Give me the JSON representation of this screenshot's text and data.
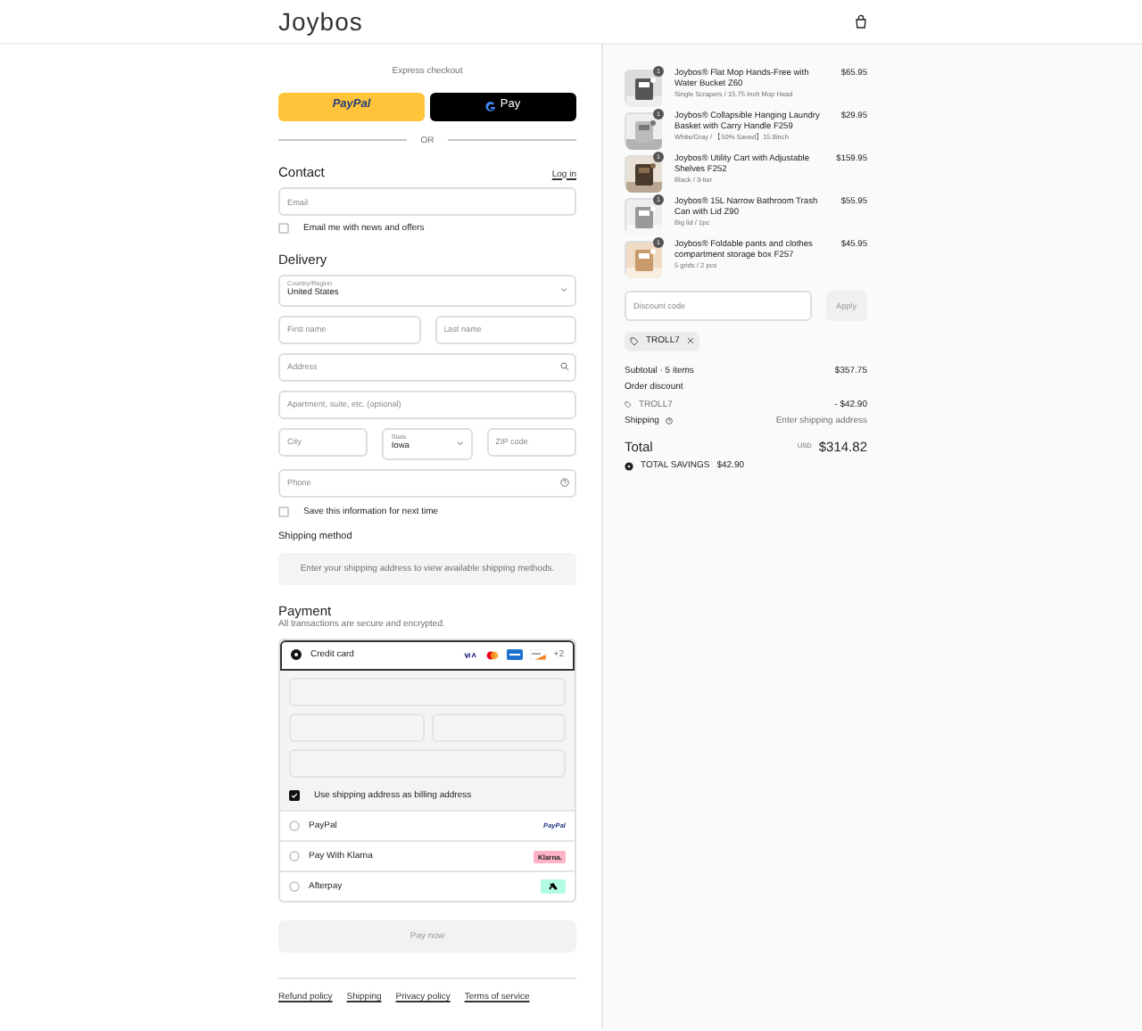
{
  "header": {
    "logo": "Joybos"
  },
  "express": {
    "title": "Express checkout",
    "buttons": [
      {
        "kind": "paypal",
        "label": "PayPal"
      },
      {
        "kind": "gpay",
        "label": "Pay"
      }
    ],
    "divider": "OR"
  },
  "contact": {
    "title": "Contact",
    "login": "Log in",
    "email_placeholder": "Email",
    "newsletter": {
      "label": "Email me with news and offers",
      "checked": false
    }
  },
  "delivery": {
    "title": "Delivery",
    "country": {
      "label": "Country/Region",
      "value": "United States"
    },
    "first_name": {
      "placeholder": "First name"
    },
    "last_name": {
      "placeholder": "Last name"
    },
    "address": {
      "placeholder": "Address"
    },
    "apartment": {
      "placeholder": "Apartment, suite, etc. (optional)"
    },
    "city": {
      "placeholder": "City"
    },
    "state": {
      "label": "State",
      "value": "Iowa"
    },
    "zip": {
      "placeholder": "ZIP code"
    },
    "phone": {
      "placeholder": "Phone"
    },
    "save": {
      "label": "Save this information for next time",
      "checked": false
    }
  },
  "shipping_method": {
    "title": "Shipping method",
    "notice": "Enter your shipping address to view available shipping methods."
  },
  "payment": {
    "title": "Payment",
    "subtitle": "All transactions are secure and encrypted.",
    "options": [
      {
        "kind": "card",
        "label": "Credit card",
        "selected": true,
        "more": "+2"
      },
      {
        "kind": "paypal",
        "label": "PayPal",
        "selected": false,
        "badge": "PayPal"
      },
      {
        "kind": "klarna",
        "label": "Pay With Klarna",
        "selected": false,
        "badge": "Klarna."
      },
      {
        "kind": "afterpay",
        "label": "Afterpay",
        "selected": false
      }
    ],
    "billing": {
      "label": "Use shipping address as billing address",
      "checked": true
    },
    "pay_button": "Pay now"
  },
  "footer_links": [
    "Refund policy",
    "Shipping",
    "Privacy policy",
    "Terms of service"
  ],
  "order": {
    "items": [
      {
        "title": "Joybos® Flat Mop Hands-Free with Water Bucket Z60",
        "variant": "Single Scrapers / 15.75 Inch Mop Head",
        "price": "$65.95",
        "quantity": "1"
      },
      {
        "title": "Joybos® Collapsible Hanging Laundry Basket with Carry Handle F259",
        "variant": "White/Gray / 【50% Saved】15.8inch",
        "price": "$29.95",
        "quantity": "1"
      },
      {
        "title": "Joybos® Utility Cart with Adjustable Shelves F252",
        "variant": "Black / 3-tier",
        "price": "$159.95",
        "quantity": "1"
      },
      {
        "title": "Joybos® 15L Narrow Bathroom Trash Can with Lid Z90",
        "variant": "Big lid / 1pc",
        "price": "$55.95",
        "quantity": "1"
      },
      {
        "title": "Joybos® Foldable pants and clothes compartment storage box F257",
        "variant": "5 grids / 2 pcs",
        "price": "$45.95",
        "quantity": "1"
      }
    ],
    "discount_placeholder": "Discount code",
    "apply": "Apply",
    "applied_code": "TROLL7",
    "subtotal_label": "Subtotal · 5 items",
    "subtotal": "$357.75",
    "order_discount_label": "Order discount",
    "discount_code": "TROLL7",
    "discount_amount": "- $42.90",
    "shipping_label": "Shipping",
    "shipping_value": "Enter shipping address",
    "total_label": "Total",
    "currency": "USD",
    "total": "$314.82",
    "savings_label": "TOTAL SAVINGS",
    "savings": "$42.90"
  }
}
